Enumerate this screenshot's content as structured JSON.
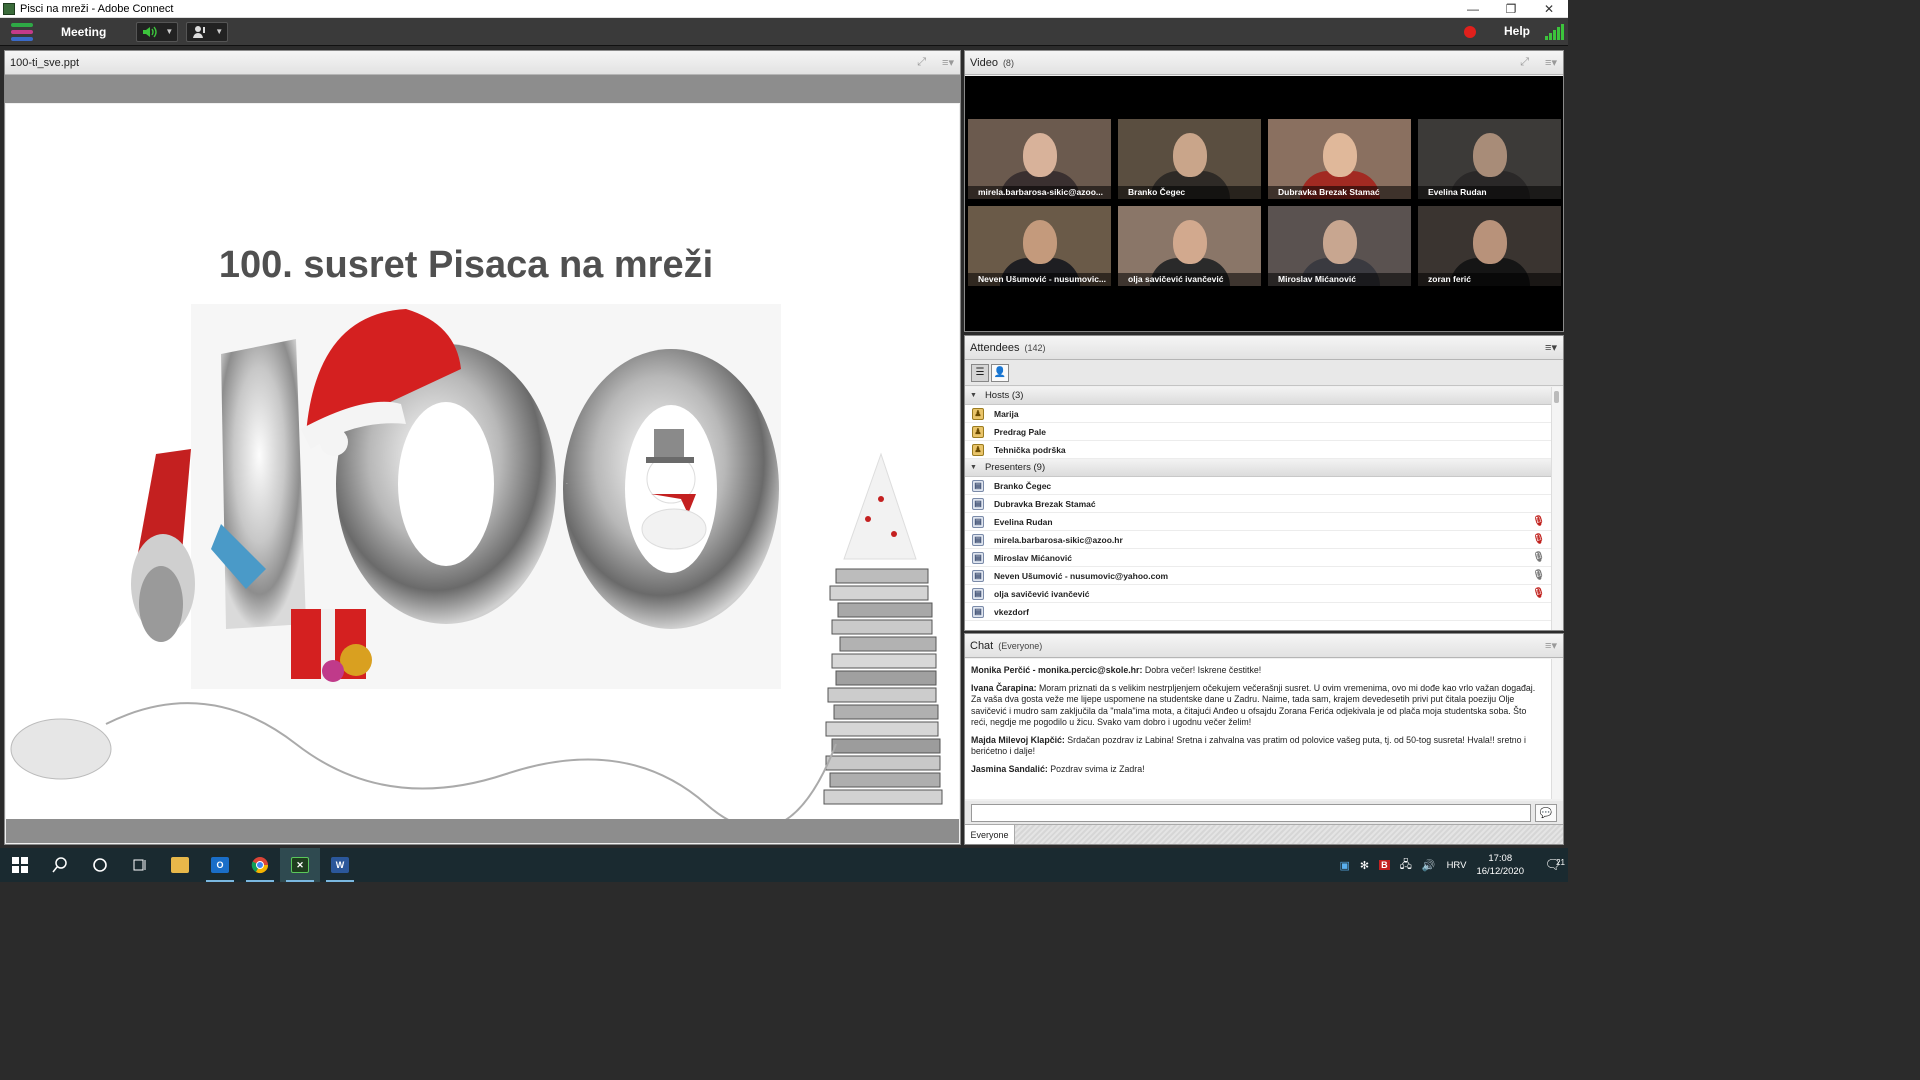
{
  "window": {
    "title": "Pisci na mreži - Adobe Connect",
    "controls": [
      "—",
      "❐",
      "✕"
    ]
  },
  "menubar": {
    "meeting_label": "Meeting",
    "help_label": "Help"
  },
  "share_pod": {
    "title": "100-ti_sve.ppt",
    "slide_title": "100. susret Pisaca na mreži",
    "slide_number_graphic": "100"
  },
  "video_pod": {
    "title": "Video",
    "count": "(8)",
    "participants": [
      {
        "name": "mirela.barbarosa-sikic@azoo...",
        "bg": "#6b5a4e",
        "skin": "#d8b29a",
        "shirt": "#3a3030"
      },
      {
        "name": "Branko Čegec",
        "bg": "#5a4e40",
        "skin": "#c9a58a",
        "shirt": "#2e2a26"
      },
      {
        "name": "Dubravka Brezak Stamać",
        "bg": "#8a7060",
        "skin": "#e0b89a",
        "shirt": "#a22a22"
      },
      {
        "name": "Evelina Rudan",
        "bg": "#3c3a38",
        "skin": "#a88c78",
        "shirt": "#2a2828"
      },
      {
        "name": "Neven Ušumović - nusumovic...",
        "bg": "#6a5a48",
        "skin": "#c49a7c",
        "shirt": "#1e1e22"
      },
      {
        "name": "olja savičević ivančević",
        "bg": "#8a7668",
        "skin": "#d2a98e",
        "shirt": "#2a2a2a"
      },
      {
        "name": "Miroslav Mićanović",
        "bg": "#5a5250",
        "skin": "#c8a690",
        "shirt": "#3a3a40"
      },
      {
        "name": "zoran ferić",
        "bg": "#3a3430",
        "skin": "#b8927a",
        "shirt": "#151515"
      }
    ]
  },
  "attendees_pod": {
    "title": "Attendees",
    "count": "(142)",
    "groups": [
      {
        "label": "Hosts (3)",
        "role": "host",
        "people": [
          {
            "name": "Marija",
            "mic": ""
          },
          {
            "name": "Predrag Pale",
            "mic": ""
          },
          {
            "name": "Tehnička podrška",
            "mic": ""
          }
        ]
      },
      {
        "label": "Presenters (9)",
        "role": "pres",
        "people": [
          {
            "name": "Branko Čegec",
            "mic": ""
          },
          {
            "name": "Dubravka Brezak Stamać",
            "mic": ""
          },
          {
            "name": "Evelina Rudan",
            "mic": "muted"
          },
          {
            "name": "mirela.barbarosa-sikic@azoo.hr",
            "mic": "muted"
          },
          {
            "name": "Miroslav Mićanović",
            "mic": "live"
          },
          {
            "name": "Neven Ušumović - nusumovic@yahoo.com",
            "mic": "live"
          },
          {
            "name": "olja savičević ivančević",
            "mic": "muted"
          },
          {
            "name": "vkezdorf",
            "mic": ""
          }
        ]
      }
    ]
  },
  "chat_pod": {
    "title": "Chat",
    "scope": "(Everyone)",
    "messages": [
      {
        "author": "Monika Perčić - monika.percic@skole.hr:",
        "text": " Dobra večer! Iskrene čestitke!"
      },
      {
        "author": "Ivana Čarapina:",
        "text": " Moram priznati da s velikim nestrpljenjem očekujem večerašnji susret. U ovim vremenima, ovo mi dođe kao vrlo važan događaj. Za vaša dva gosta veže me lijepe uspomene na studentske dane u Zadru. Naime, tada sam, krajem devedesetih privi put čitala poeziju Olje savičević i mudro sam zaključila da \"mala\"ima mota, a čitajući Anđeo u ofsajdu Zorana Ferića odjekivala je od plača moja studentska soba. Što reći, negdje me pogodilo u žicu. Svako vam dobro i ugodnu večer želim!"
      },
      {
        "author": "Majda Milevoj Klapčić:",
        "text": " Srdačan pozdrav iz Labina! Sretna i zahvalna vas pratim od polovice vašeg puta, tj. od 50-tog susreta! Hvala!! sretno i berićetno i dalje!"
      },
      {
        "author": "Jasmina Sandalić:",
        "text": " Pozdrav svima iz Zadra!"
      }
    ],
    "tab_label": "Everyone",
    "input_value": ""
  },
  "taskbar": {
    "apps": [
      "start",
      "search",
      "cortana",
      "task-view",
      "file-explorer",
      "outlook",
      "chrome",
      "adobe-connect",
      "word"
    ],
    "language": "HRV",
    "time": "17:08",
    "date": "16/12/2020",
    "notification_count": "21"
  }
}
